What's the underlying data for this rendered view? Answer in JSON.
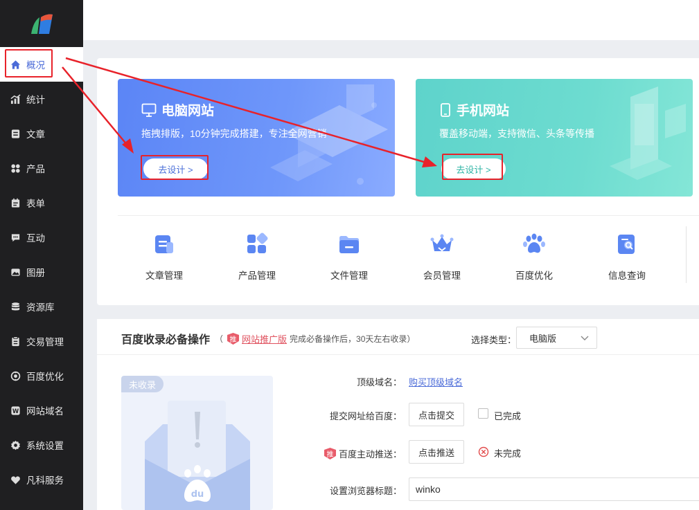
{
  "sidebar": {
    "items": [
      {
        "label": "概况",
        "icon": "home-icon"
      },
      {
        "label": "统计",
        "icon": "chart-icon"
      },
      {
        "label": "文章",
        "icon": "article-icon"
      },
      {
        "label": "产品",
        "icon": "grid-icon"
      },
      {
        "label": "表单",
        "icon": "form-icon"
      },
      {
        "label": "互动",
        "icon": "chat-icon"
      },
      {
        "label": "图册",
        "icon": "album-icon"
      },
      {
        "label": "资源库",
        "icon": "database-icon"
      },
      {
        "label": "交易管理",
        "icon": "trade-icon"
      },
      {
        "label": "百度优化",
        "icon": "seo-icon"
      },
      {
        "label": "网站域名",
        "icon": "domain-icon"
      },
      {
        "label": "系统设置",
        "icon": "gear-icon"
      },
      {
        "label": "凡科服务",
        "icon": "heart-icon"
      }
    ]
  },
  "banners": {
    "pc": {
      "title": "电脑网站",
      "desc": "拖拽排版，10分钟完成搭建，专注全网营销",
      "button": "去设计 >"
    },
    "mobile": {
      "title": "手机网站",
      "desc": "覆盖移动端，支持微信、头条等传播",
      "button": "去设计 >"
    }
  },
  "tools": [
    {
      "label": "文章管理",
      "icon": "article-manage-icon"
    },
    {
      "label": "产品管理",
      "icon": "product-manage-icon"
    },
    {
      "label": "文件管理",
      "icon": "file-manage-icon"
    },
    {
      "label": "会员管理",
      "icon": "member-crown-icon"
    },
    {
      "label": "百度优化",
      "icon": "baidu-paw-icon"
    },
    {
      "label": "信息查询",
      "icon": "info-search-icon"
    }
  ],
  "baidu": {
    "title": "百度收录必备操作",
    "note_open": "（",
    "badge": "推",
    "note_link": "网站推广版",
    "note_text": "完成必备操作后，30天左右收录",
    "note_close": "）",
    "type_label": "选择类型：",
    "type_value": "电脑版",
    "illus_tag": "未收录",
    "rows": {
      "domain_label": "顶级域名：",
      "domain_link": "购买顶级域名",
      "submit_label": "提交网址给百度：",
      "submit_button": "点击提交",
      "submit_status": "已完成",
      "push_badge": "推",
      "push_label": "百度主动推送：",
      "push_button": "点击推送",
      "push_status": "未完成",
      "title_label": "设置浏览器标题：",
      "title_value": "winko"
    }
  },
  "colors": {
    "accent": "#4b6bd8",
    "sidebar": "#1f1f21",
    "annotation": "#e8222a"
  }
}
